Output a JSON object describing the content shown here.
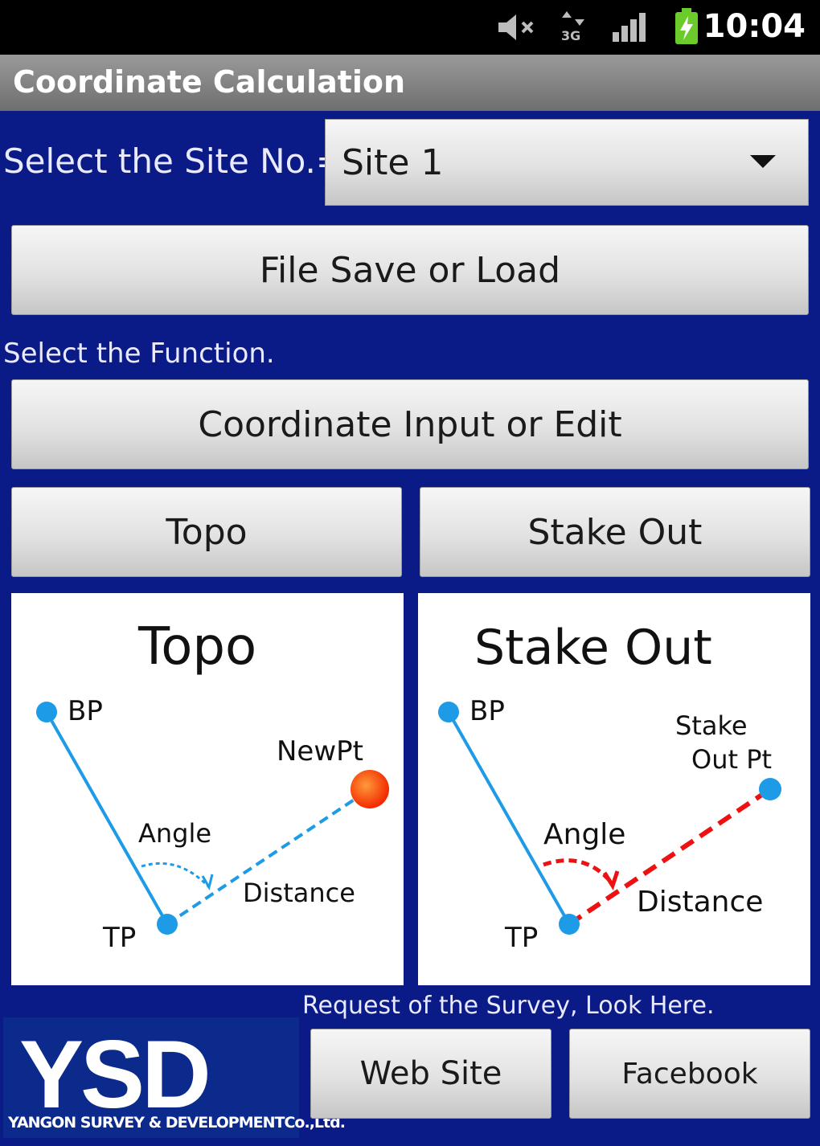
{
  "status": {
    "time": "10:04",
    "icons": [
      "mute-icon",
      "network-3g-icon",
      "signal-icon",
      "battery-charging-icon"
    ]
  },
  "title": "Coordinate Calculation",
  "site": {
    "label": "Select the Site No.=",
    "selected": "Site 1"
  },
  "buttons": {
    "file": "File Save or Load",
    "coordinate": "Coordinate Input or Edit",
    "topo": "Topo",
    "stake_out": "Stake Out",
    "web_site": "Web Site",
    "facebook": "Facebook"
  },
  "function_label": "Select the Function.",
  "topo_diagram": {
    "title": "Topo",
    "bp": "BP",
    "tp": "TP",
    "new_pt": "NewPt",
    "angle": "Angle",
    "distance": "Distance"
  },
  "stake_diagram": {
    "title": "Stake Out",
    "bp": "BP",
    "tp": "TP",
    "stake_line1": "Stake",
    "stake_line2": "Out Pt",
    "angle": "Angle",
    "distance": "Distance"
  },
  "request_text": "Request of the Survey, Look Here.",
  "logo": {
    "big": "YSD",
    "small": "YANGON SURVEY & DEVELOPMENTCo.,Ltd."
  },
  "colors": {
    "background": "#0a1a86",
    "line_blue": "#1e9be6",
    "line_red": "#ee1111"
  }
}
